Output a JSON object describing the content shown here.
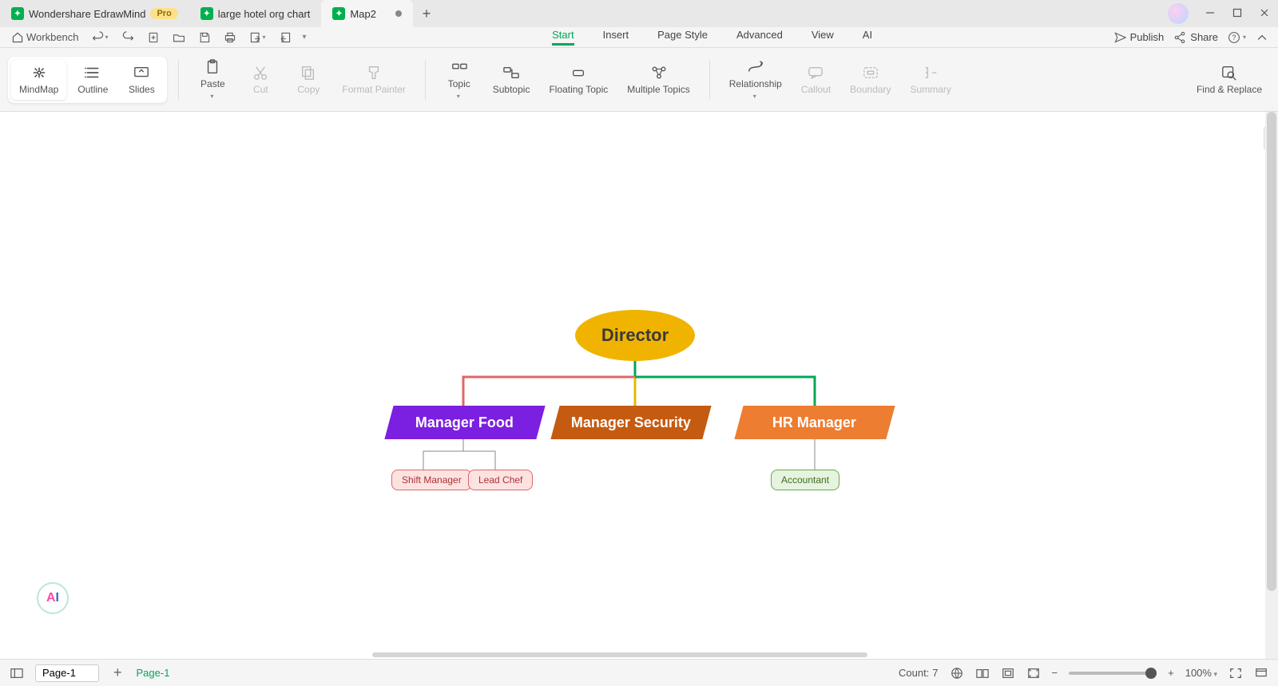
{
  "app": {
    "name": "Wondershare EdrawMind",
    "badge": "Pro"
  },
  "tabs": [
    {
      "label": "large hotel org chart",
      "dirty": false,
      "active": false
    },
    {
      "label": "Map2",
      "dirty": true,
      "active": true
    }
  ],
  "quick": {
    "workbench": "Workbench"
  },
  "menus": {
    "start": "Start",
    "insert": "Insert",
    "page_style": "Page Style",
    "advanced": "Advanced",
    "view": "View",
    "ai": "AI"
  },
  "menu_right": {
    "publish": "Publish",
    "share": "Share"
  },
  "view_modes": {
    "mindmap": "MindMap",
    "outline": "Outline",
    "slides": "Slides"
  },
  "ribbon": {
    "paste": "Paste",
    "cut": "Cut",
    "copy": "Copy",
    "format_painter": "Format Painter",
    "topic": "Topic",
    "subtopic": "Subtopic",
    "floating_topic": "Floating Topic",
    "multiple_topics": "Multiple Topics",
    "relationship": "Relationship",
    "callout": "Callout",
    "boundary": "Boundary",
    "summary": "Summary",
    "find_replace": "Find & Replace"
  },
  "chart_data": {
    "type": "org-chart",
    "root": {
      "label": "Director",
      "color": "#f0b400",
      "children": [
        {
          "label": "Manager Food",
          "color": "#7b1fe0",
          "edge_color": "#e06666",
          "children": [
            {
              "label": "Shift Manager",
              "border": "#e06666",
              "fill": "#fde2e2"
            },
            {
              "label": "Lead Chef",
              "border": "#e06666",
              "fill": "#fde2e2"
            }
          ]
        },
        {
          "label": "Manager Security",
          "color": "#c55a11",
          "edge_color": "#e6b800",
          "children": []
        },
        {
          "label": "HR Manager",
          "color": "#ed7d31",
          "edge_color": "#00a856",
          "children": [
            {
              "label": "Accountant",
              "border": "#6aa84f",
              "fill": "#e6f3df"
            }
          ]
        }
      ]
    }
  },
  "status": {
    "count_label": "Count:",
    "count": "7",
    "zoom": "100%",
    "page_selector": "Page-1",
    "page_link": "Page-1"
  }
}
